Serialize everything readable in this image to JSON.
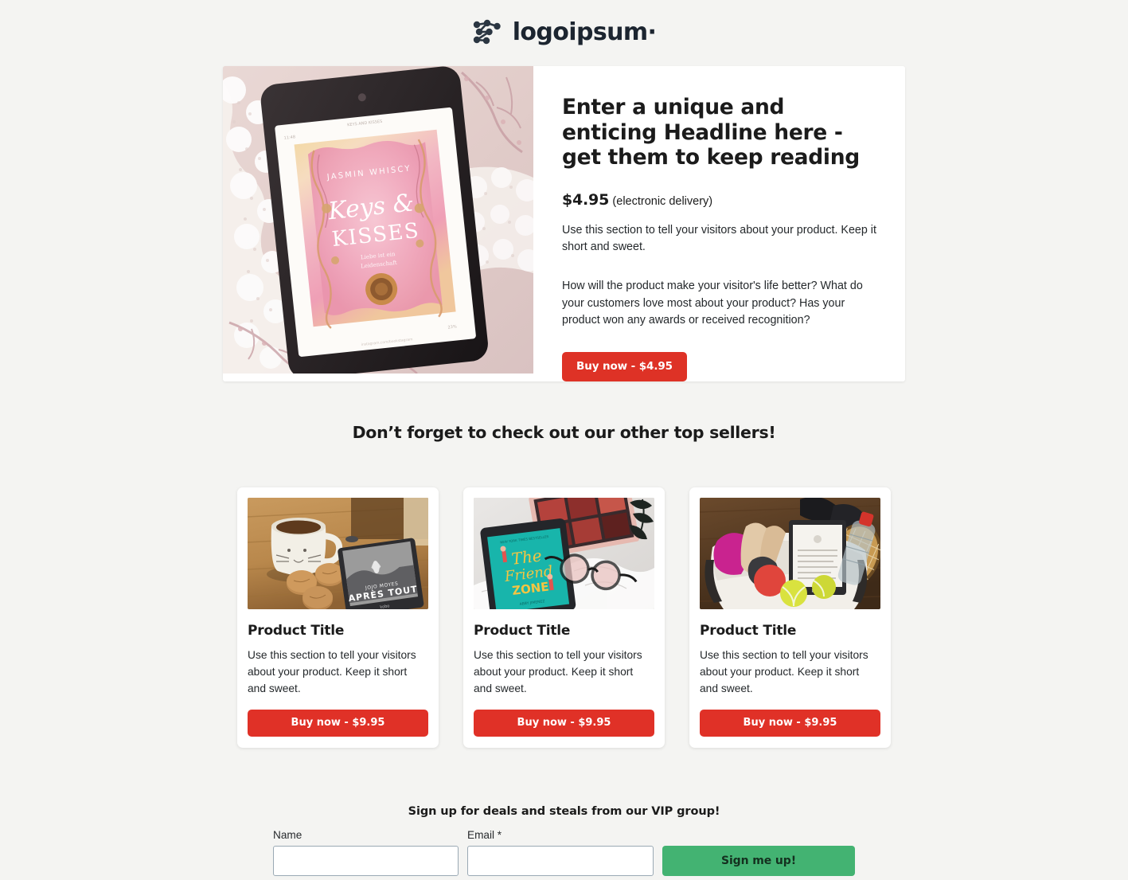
{
  "brand": {
    "name": "logoipsum",
    "mark_icon": "network-nodes-icon",
    "trademark_dot": "·"
  },
  "hero": {
    "image_alt": "e-reader showing pink romance book cover on lace",
    "image": {
      "book_author": "JASMIN WHISCY",
      "book_title_line1": "Keys &",
      "book_title_line2": "KISSES"
    },
    "headline": "Enter a unique and enticing Headline here - get them to keep reading",
    "price": "$4.95",
    "price_note": "(electronic delivery)",
    "paragraph_1": "Use this section to tell your visitors about your product. Keep it short and sweet.",
    "paragraph_2": "How will the product make your visitor's life better? What do your customers love most about your product? Has your product won any awards or received recognition?",
    "buy_button": "Buy now - $4.95"
  },
  "top_sellers": {
    "heading": "Don’t forget to check out our other top sellers!",
    "cards": [
      {
        "title": "Product Title",
        "text": "Use this section to tell your visitors about your product. Keep it short and sweet.",
        "button": "Buy now - $9.95",
        "image_alt": "cat mug with coffee, cookies and e-reader on wooden table"
      },
      {
        "title": "Product Title",
        "text": "Use this section to tell your visitors about your product. Keep it short and sweet.",
        "button": "Buy now - $9.95",
        "image_alt": "tablet with teal book cover, glasses and magazine on white sheets"
      },
      {
        "title": "Product Title",
        "text": "Use this section to tell your visitors about your product. Keep it short and sweet.",
        "button": "Buy now - $9.95",
        "image_alt": "sports bag with e-reader, tennis balls, racket and water bottle"
      }
    ]
  },
  "signup": {
    "heading": "Sign up for deals and steals from our VIP group!",
    "name_label": "Name",
    "name_value": "",
    "name_placeholder": "",
    "email_label": "Email *",
    "email_value": "",
    "email_placeholder": "",
    "submit_button": "Sign me up!"
  },
  "colors": {
    "page_background": "#f4f4f2",
    "buy_red": "#de3226",
    "signup_green": "#43b372",
    "text": "#1b1b1b",
    "input_border": "#9aa9b4"
  }
}
